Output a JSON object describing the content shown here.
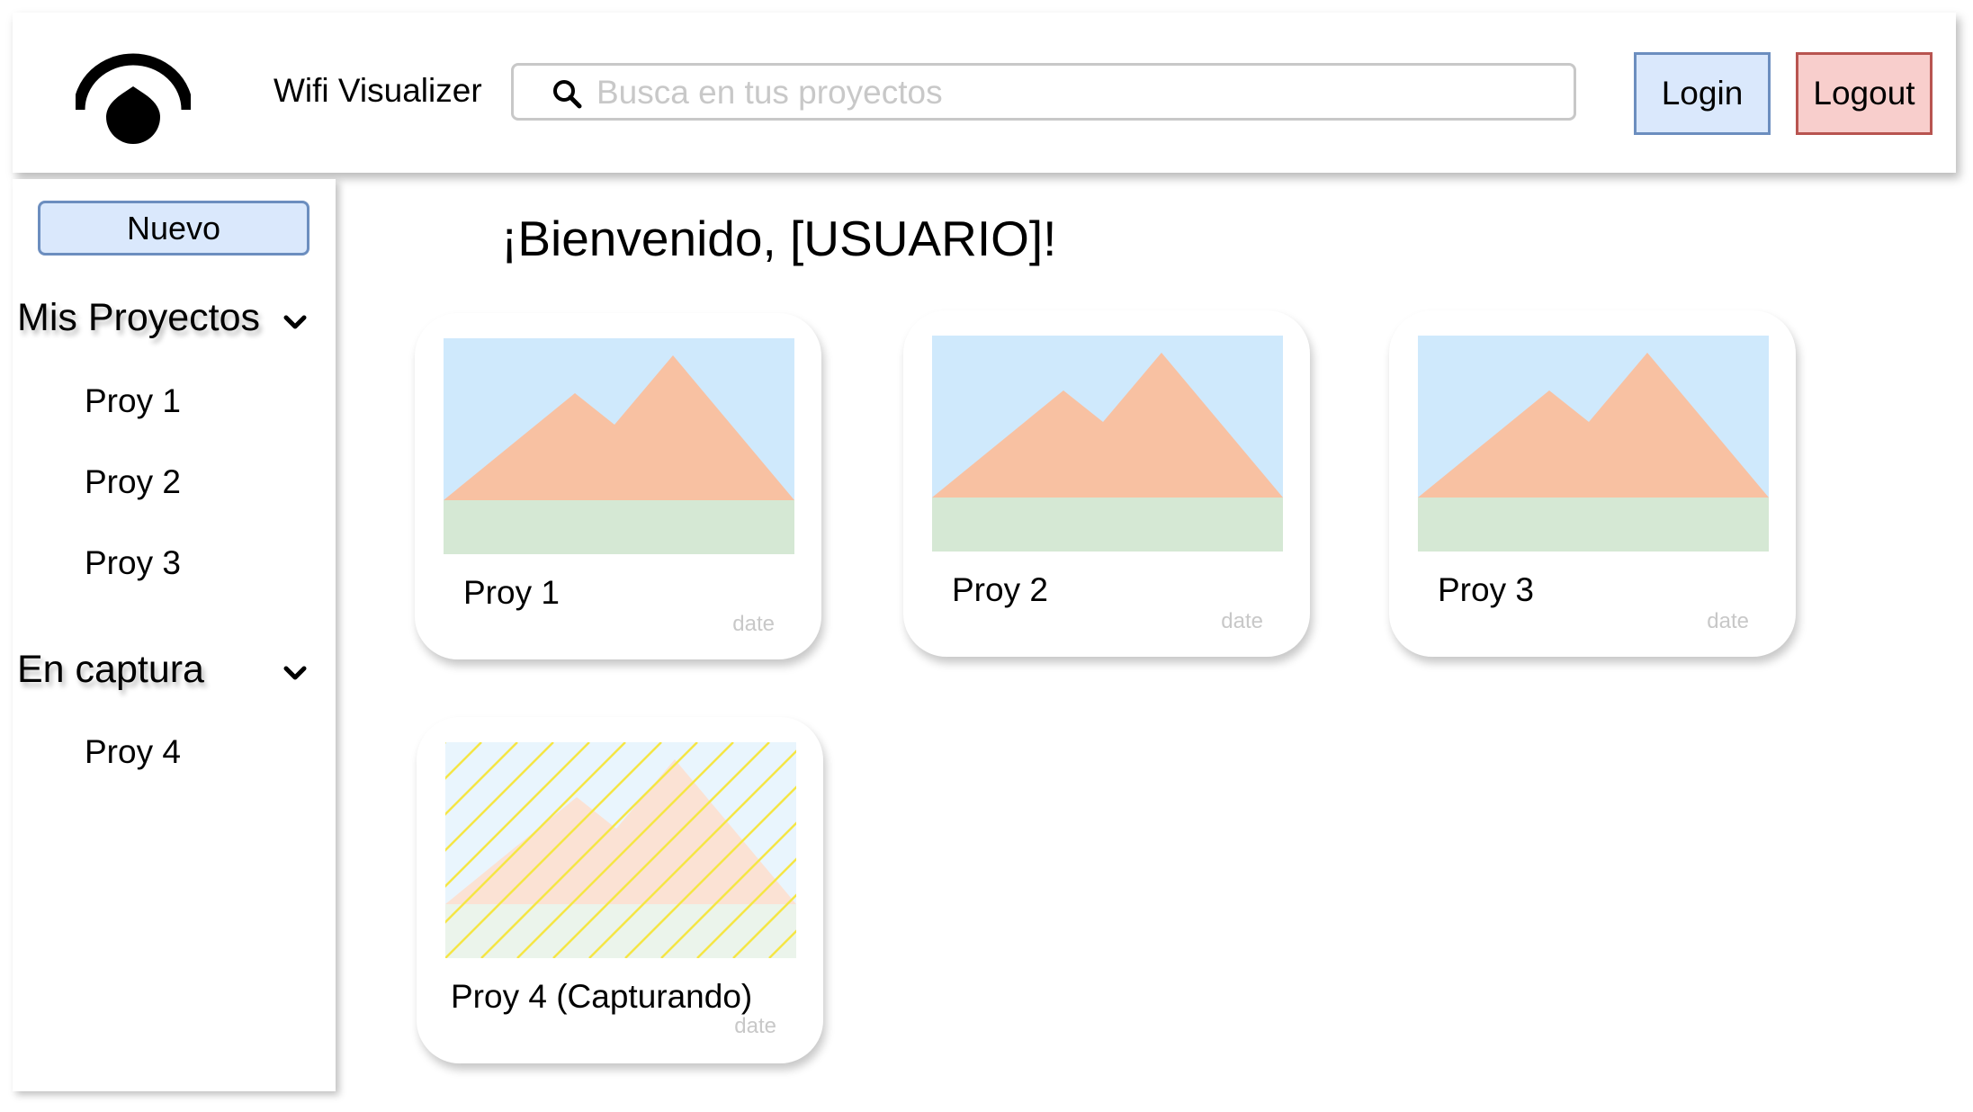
{
  "header": {
    "app_title": "Wifi Visualizer",
    "logo_icon": "eye-logo-icon",
    "search": {
      "placeholder": "Busca en tus proyectos",
      "value": "",
      "icon": "search-icon"
    },
    "login_label": "Login",
    "logout_label": "Logout"
  },
  "sidebar": {
    "new_label": "Nuevo",
    "sections": [
      {
        "title": "Mis Proyectos",
        "icon": "chevron-down-icon",
        "items": [
          "Proy 1",
          "Proy 2",
          "Proy 3"
        ]
      },
      {
        "title": "En captura",
        "icon": "chevron-down-icon",
        "items": [
          "Proy 4"
        ]
      }
    ]
  },
  "main": {
    "welcome": "¡Bienvenido, [USUARIO]!",
    "cards": [
      {
        "title": "Proy 1",
        "date": "date",
        "capturing": false
      },
      {
        "title": "Proy 2",
        "date": "date",
        "capturing": false
      },
      {
        "title": "Proy 3",
        "date": "date",
        "capturing": false
      },
      {
        "title": "Proy 4 (Capturando)",
        "date": "date",
        "capturing": true
      }
    ]
  },
  "colors": {
    "login_bg": "#dae8fc",
    "login_border": "#6c8ebf",
    "logout_bg": "#f8cecc",
    "logout_border": "#b85450",
    "thumb_sky": "#cfe9fc",
    "thumb_mountain": "#f8c1a2",
    "thumb_ground": "#d5e8d4",
    "capture_hatch": "#f5e645"
  }
}
